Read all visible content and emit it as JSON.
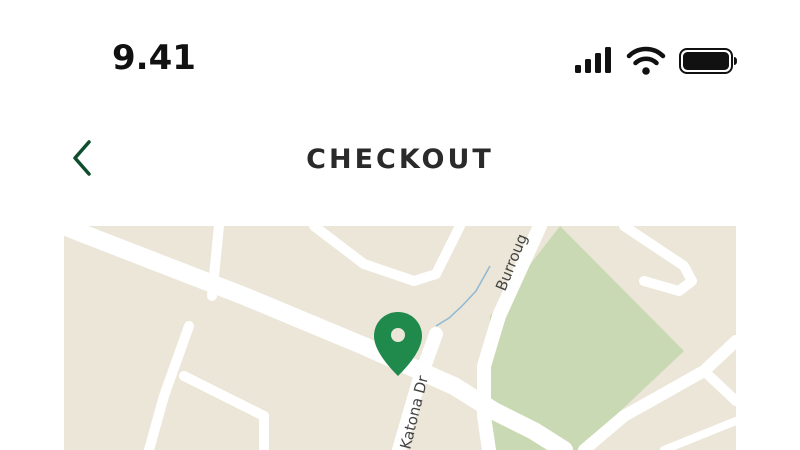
{
  "status_bar": {
    "time": "9.41",
    "icons": [
      "cellular-signal-icon",
      "wifi-icon",
      "battery-icon"
    ]
  },
  "header": {
    "title": "CHECKOUT",
    "back_icon": "chevron-left-icon"
  },
  "map": {
    "street_labels": {
      "burroughs": "Burroug",
      "katona": "Katona Dr"
    },
    "pin_color": "#1f8a4c",
    "park_color": "#c9d9b3",
    "land_color": "#ebe6d7",
    "road_color": "#ffffff"
  },
  "colors": {
    "accent": "#0f4d2f"
  }
}
